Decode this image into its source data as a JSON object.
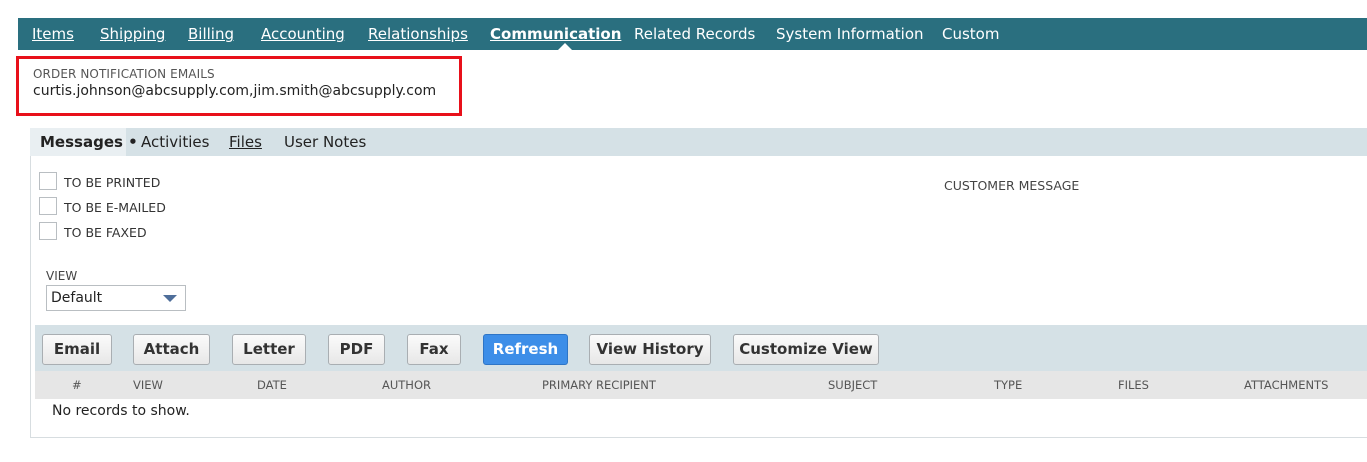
{
  "nav": {
    "tabs": [
      {
        "label": "Items",
        "underline_char": "I",
        "active": false
      },
      {
        "label": "Shipping",
        "underline_char": "S",
        "active": false
      },
      {
        "label": "Billing",
        "underline_char": "B",
        "active": false
      },
      {
        "label": "Accounting",
        "underline_char": "A",
        "active": false
      },
      {
        "label": "Relationships",
        "underline_char": "R",
        "active": false
      },
      {
        "label": "Communication",
        "underline_char": "C",
        "active": true
      },
      {
        "label": "Related Records",
        "underline_char": "l",
        "active": false
      },
      {
        "label": "System Information",
        "underline_char": "",
        "active": false
      },
      {
        "label": "Custom",
        "underline_char": "u",
        "active": false
      }
    ]
  },
  "order_notification": {
    "label": "ORDER NOTIFICATION EMAILS",
    "value": "curtis.johnson@abcsupply.com,jim.smith@abcsupply.com"
  },
  "subtabs": [
    {
      "label": "Messages •",
      "active": true
    },
    {
      "label": "Activities",
      "active": false
    },
    {
      "label": "Files",
      "active": false
    },
    {
      "label": "User Notes",
      "active": false
    }
  ],
  "checkboxes": [
    {
      "label": "TO BE PRINTED",
      "checked": false
    },
    {
      "label": "TO BE E-MAILED",
      "checked": false
    },
    {
      "label": "TO BE FAXED",
      "checked": false
    }
  ],
  "customer_message_label": "CUSTOMER MESSAGE",
  "view": {
    "label": "VIEW",
    "selected": "Default"
  },
  "toolbar": {
    "email": "Email",
    "attach": "Attach",
    "letter": "Letter",
    "pdf": "PDF",
    "fax": "Fax",
    "refresh": "Refresh",
    "view_history": "View History",
    "customize_view": "Customize View"
  },
  "table": {
    "columns": [
      "#",
      "VIEW",
      "DATE",
      "AUTHOR",
      "PRIMARY RECIPIENT",
      "SUBJECT",
      "TYPE",
      "FILES",
      "ATTACHMENTS"
    ],
    "empty_text": "No records to show."
  },
  "colors": {
    "nav_bg": "#2a6f7f",
    "subtab_bg": "#d5e1e6",
    "primary_button": "#3d8ee8",
    "highlight_border": "#e8101a"
  }
}
